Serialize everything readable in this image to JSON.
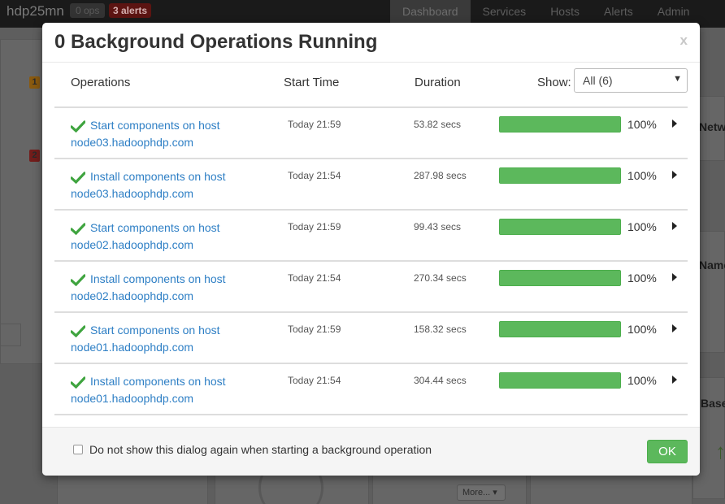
{
  "topbar": {
    "cluster_name": "hdp25mn",
    "ops_badge": "0 ops",
    "alerts_badge": "3 alerts",
    "nav": [
      {
        "label": "Dashboard",
        "active": true
      },
      {
        "label": "Services",
        "active": false
      },
      {
        "label": "Hosts",
        "active": false
      },
      {
        "label": "Alerts",
        "active": false
      },
      {
        "label": "Admin",
        "active": false
      }
    ]
  },
  "background": {
    "badge_1": "1",
    "badge_2": "2",
    "partial_netwo": "Netwo",
    "partial_name": "Name",
    "partial_base": "Base",
    "more_button": "More..."
  },
  "modal": {
    "title": "0 Background Operations Running",
    "close_label": "x",
    "columns": {
      "operations": "Operations",
      "start_time": "Start Time",
      "duration": "Duration"
    },
    "show_label": "Show:",
    "show_value": "All (6)",
    "operations": [
      {
        "name": "Start components on host node03.hadoophdp.com",
        "start": "Today 21:59",
        "duration": "53.82 secs",
        "progress": 100,
        "progress_label": "100%"
      },
      {
        "name": "Install components on host node03.hadoophdp.com",
        "start": "Today 21:54",
        "duration": "287.98 secs",
        "progress": 100,
        "progress_label": "100%"
      },
      {
        "name": "Start components on host node02.hadoophdp.com",
        "start": "Today 21:59",
        "duration": "99.43 secs",
        "progress": 100,
        "progress_label": "100%"
      },
      {
        "name": "Install components on host node02.hadoophdp.com",
        "start": "Today 21:54",
        "duration": "270.34 secs",
        "progress": 100,
        "progress_label": "100%"
      },
      {
        "name": "Start components on host node01.hadoophdp.com",
        "start": "Today 21:59",
        "duration": "158.32 secs",
        "progress": 100,
        "progress_label": "100%"
      },
      {
        "name": "Install components on host node01.hadoophdp.com",
        "start": "Today 21:54",
        "duration": "304.44 secs",
        "progress": 100,
        "progress_label": "100%"
      }
    ],
    "footer": {
      "checkbox_label": "Do not show this dialog again when starting a background operation",
      "checkbox_checked": false,
      "ok_label": "OK"
    }
  },
  "colors": {
    "success_green": "#5cb85c",
    "link_blue": "#2e7fc5",
    "check_green": "#3fa43f"
  },
  "icons": {
    "row_status": "check-icon",
    "row_expand": "caret-right-icon",
    "select_caret": "caret-down-icon"
  }
}
